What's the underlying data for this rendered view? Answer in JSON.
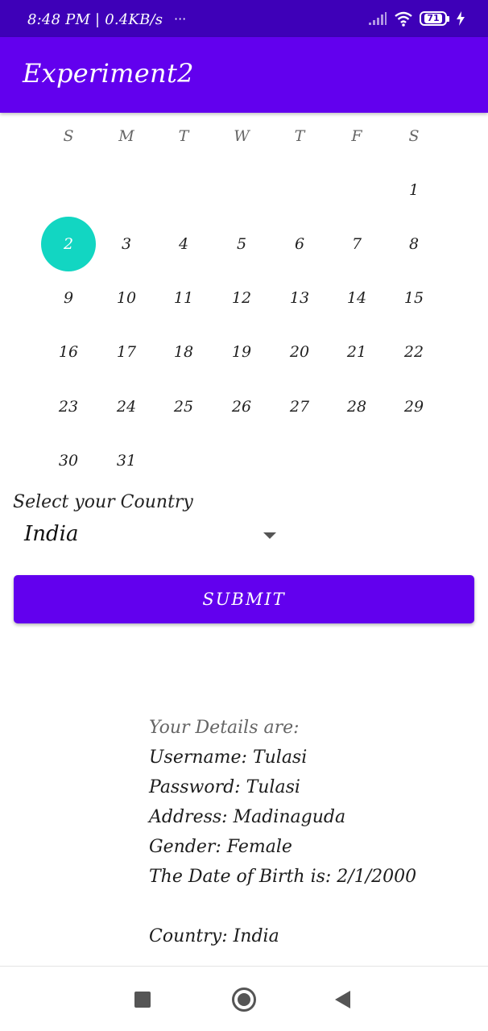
{
  "status_bar": {
    "time_text": "8:48 PM | 0.4KB/s",
    "more_dots": "···",
    "battery_level": "71",
    "icons": [
      "signal-icon",
      "wifi-icon",
      "battery-icon",
      "charging-icon"
    ]
  },
  "app_bar": {
    "title": "Experiment2",
    "color": "#6200ee"
  },
  "calendar": {
    "weekdays": [
      "S",
      "M",
      "T",
      "W",
      "T",
      "F",
      "S"
    ],
    "selected_day": "2",
    "selected_color": "#12d6c2",
    "weeks": [
      [
        "",
        "",
        "",
        "",
        "",
        "",
        "1"
      ],
      [
        "2",
        "3",
        "4",
        "5",
        "6",
        "7",
        "8"
      ],
      [
        "9",
        "10",
        "11",
        "12",
        "13",
        "14",
        "15"
      ],
      [
        "16",
        "17",
        "18",
        "19",
        "20",
        "21",
        "22"
      ],
      [
        "23",
        "24",
        "25",
        "26",
        "27",
        "28",
        "29"
      ],
      [
        "30",
        "31",
        "",
        "",
        "",
        "",
        ""
      ]
    ]
  },
  "country": {
    "label": "Select your Country",
    "selected_value": "India"
  },
  "submit": {
    "label": "SUBMIT"
  },
  "details": {
    "header": "Your Details are:",
    "username": "Username: Tulasi",
    "password": "Password: Tulasi",
    "address": "Address: Madinaguda",
    "gender": "Gender: Female",
    "dob": "The Date of Birth is: 2/1/2000",
    "country": "Country: India"
  },
  "nav_bar": {
    "icons": [
      "recents-square-icon",
      "home-circle-icon",
      "back-triangle-icon"
    ]
  }
}
